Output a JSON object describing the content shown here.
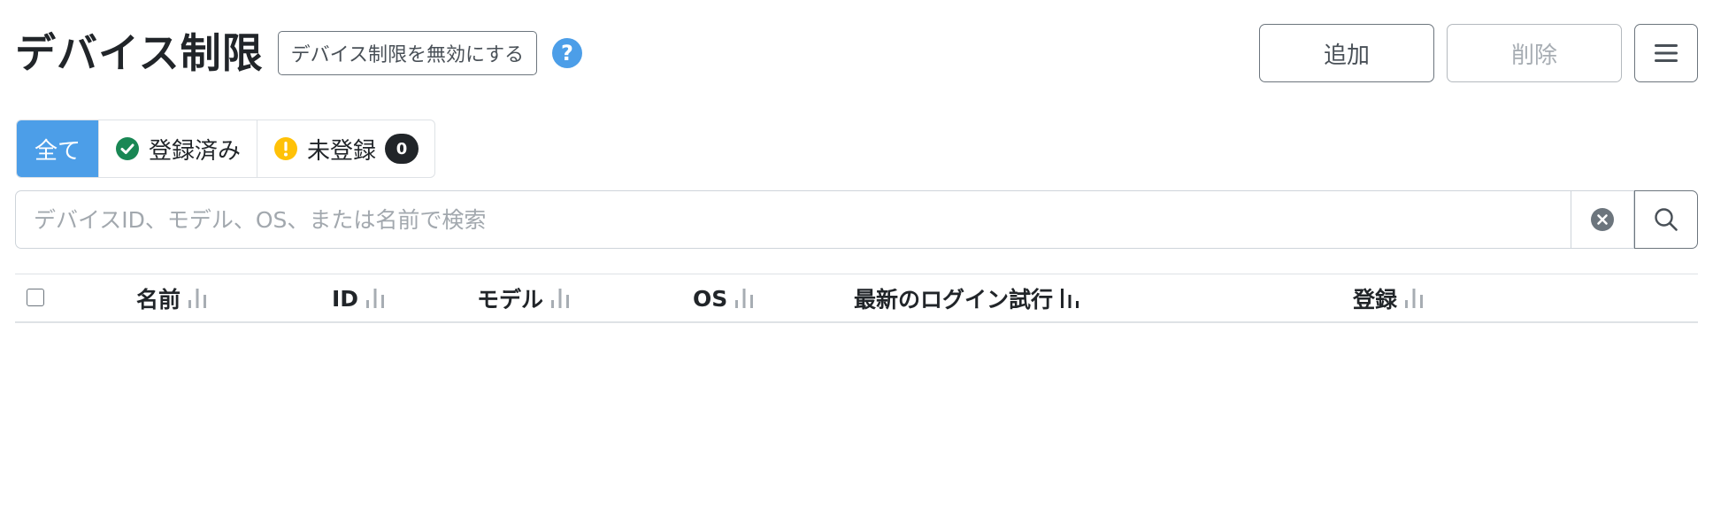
{
  "header": {
    "title": "デバイス制限",
    "disable_label": "デバイス制限を無効にする",
    "help_icon": "question-circle-icon"
  },
  "actions": {
    "add_label": "追加",
    "delete_label": "削除",
    "menu_icon": "hamburger-menu-icon"
  },
  "filters": {
    "all_label": "全て",
    "registered_label": "登録済み",
    "unregistered_label": "未登録",
    "unregistered_count": "0"
  },
  "search": {
    "placeholder": "デバイスID、モデル、OS、または名前で検索",
    "value": ""
  },
  "table": {
    "columns": [
      "名前",
      "ID",
      "モデル",
      "OS",
      "最新のログイン試行",
      "登録"
    ],
    "sorted_column": "最新のログイン試行",
    "rows": []
  },
  "colors": {
    "accent": "#4c9ee8",
    "success": "#198754",
    "warning": "#ffc107",
    "dark": "#212529",
    "muted": "#6c757d"
  }
}
